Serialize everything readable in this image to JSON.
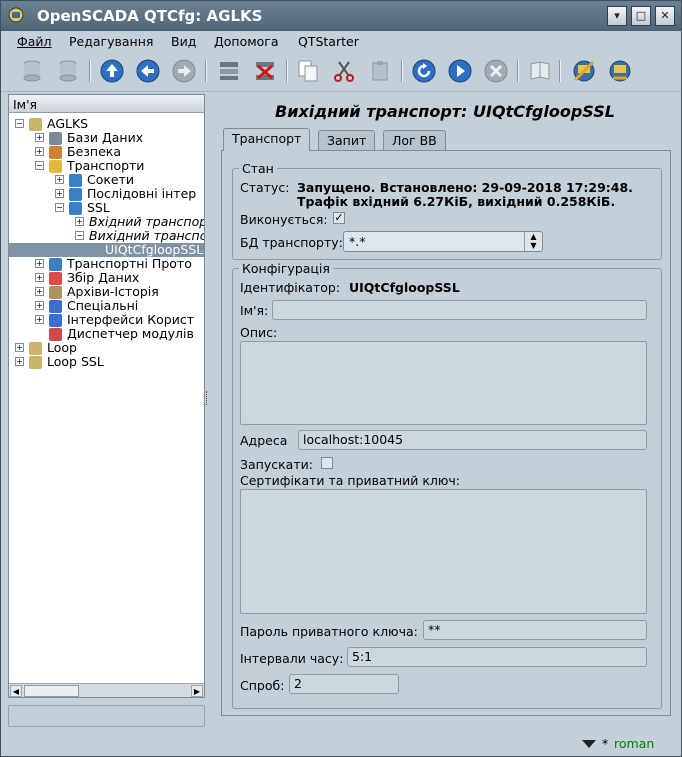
{
  "window": {
    "title": "OpenSCADA QTCfg: AGLKS",
    "buttons": [
      "▾",
      "□",
      "✕"
    ]
  },
  "menu": [
    "Файл",
    "Редагування",
    "Вид",
    "Допомога",
    "QTStarter"
  ],
  "toolbar_icons": [
    "db-load-icon",
    "db-save-icon",
    "up-icon",
    "back-icon",
    "forward-icon",
    "add-item-icon",
    "delete-item-icon",
    "copy-icon",
    "cut-icon",
    "paste-icon",
    "refresh-icon",
    "start-icon",
    "stop-icon",
    "manual-icon",
    "station-icon-1",
    "station-icon-2"
  ],
  "tree": {
    "header": "Ім'я",
    "items": [
      {
        "label": "AGLKS",
        "level": 0,
        "exp": "⊟",
        "icon": "folder"
      },
      {
        "label": "Бази Даних",
        "level": 1,
        "exp": "⊞",
        "icon": "db"
      },
      {
        "label": "Безпека",
        "level": 1,
        "exp": "⊞",
        "icon": "security"
      },
      {
        "label": "Транспорти",
        "level": 1,
        "exp": "⊟",
        "icon": "transport"
      },
      {
        "label": "Сокети",
        "level": 2,
        "exp": "⊞",
        "icon": "module"
      },
      {
        "label": "Послідовні інтер",
        "level": 2,
        "exp": "⊞",
        "icon": "module"
      },
      {
        "label": "SSL",
        "level": 2,
        "exp": "⊟",
        "icon": "module"
      },
      {
        "label": "Вхідний транспор",
        "level": 3,
        "exp": "⊞",
        "icon": "",
        "italic": true
      },
      {
        "label": "Вихідний транспо",
        "level": 3,
        "exp": "⊟",
        "icon": "",
        "italic": true
      },
      {
        "label": "UIQtCfgloopSSL",
        "level": 4,
        "exp": "",
        "icon": "",
        "selected": true
      },
      {
        "label": "Транспортні Прото",
        "level": 1,
        "exp": "⊞",
        "icon": "protocol"
      },
      {
        "label": "Збір Даних",
        "level": 1,
        "exp": "⊞",
        "icon": "daq"
      },
      {
        "label": "Архіви-Історія",
        "level": 1,
        "exp": "⊞",
        "icon": "archive"
      },
      {
        "label": "Спеціальні",
        "level": 1,
        "exp": "⊞",
        "icon": "special"
      },
      {
        "label": "Інтерфейси Корист",
        "level": 1,
        "exp": "⊞",
        "icon": "ui"
      },
      {
        "label": "Диспетчер модулів",
        "level": 1,
        "exp": "",
        "icon": "modsched"
      },
      {
        "label": "Loop",
        "level": 0,
        "exp": "⊞",
        "icon": "folder"
      },
      {
        "label": "Loop SSL",
        "level": 0,
        "exp": "⊞",
        "icon": "folder"
      }
    ]
  },
  "page": {
    "title": "Вихідний транспорт: UIQtCfgloopSSL",
    "tabs": [
      "Транспорт",
      "Запит",
      "Лог ВВ"
    ],
    "state": {
      "group": "Стан",
      "status_label": "Статус:",
      "status_line1": "Запущено. Встановлено: 29-09-2018 17:29:48.",
      "status_line2": "Трафік вхідний 6.27КіБ, вихідний 0.258КіБ.",
      "running_label": "Виконується:",
      "running_checked": true,
      "db_label": "БД транспорту:",
      "db_value": "*.*"
    },
    "config": {
      "group": "Конфігурація",
      "id_label": "Ідентифікатор:",
      "id_value": "UIQtCfgloopSSL",
      "name_label": "Ім'я:",
      "name_value": "",
      "descr_label": "Опис:",
      "addr_label": "Адреса",
      "addr_value": "localhost:10045",
      "start_label": "Запускати:",
      "start_checked": false,
      "cert_label": "Сертифікати та приватний ключ:",
      "pkey_label": "Пароль приватного ключа:",
      "pkey_value": "**",
      "tm_label": "Інтервали часу:",
      "tm_value": "5:1",
      "attempts_label": "Спроб:",
      "attempts_value": "2"
    }
  },
  "statusbar": {
    "user_prefix": "*",
    "user": "roman"
  },
  "colors": {
    "selection": "#7f93a4",
    "user": "#008000"
  }
}
